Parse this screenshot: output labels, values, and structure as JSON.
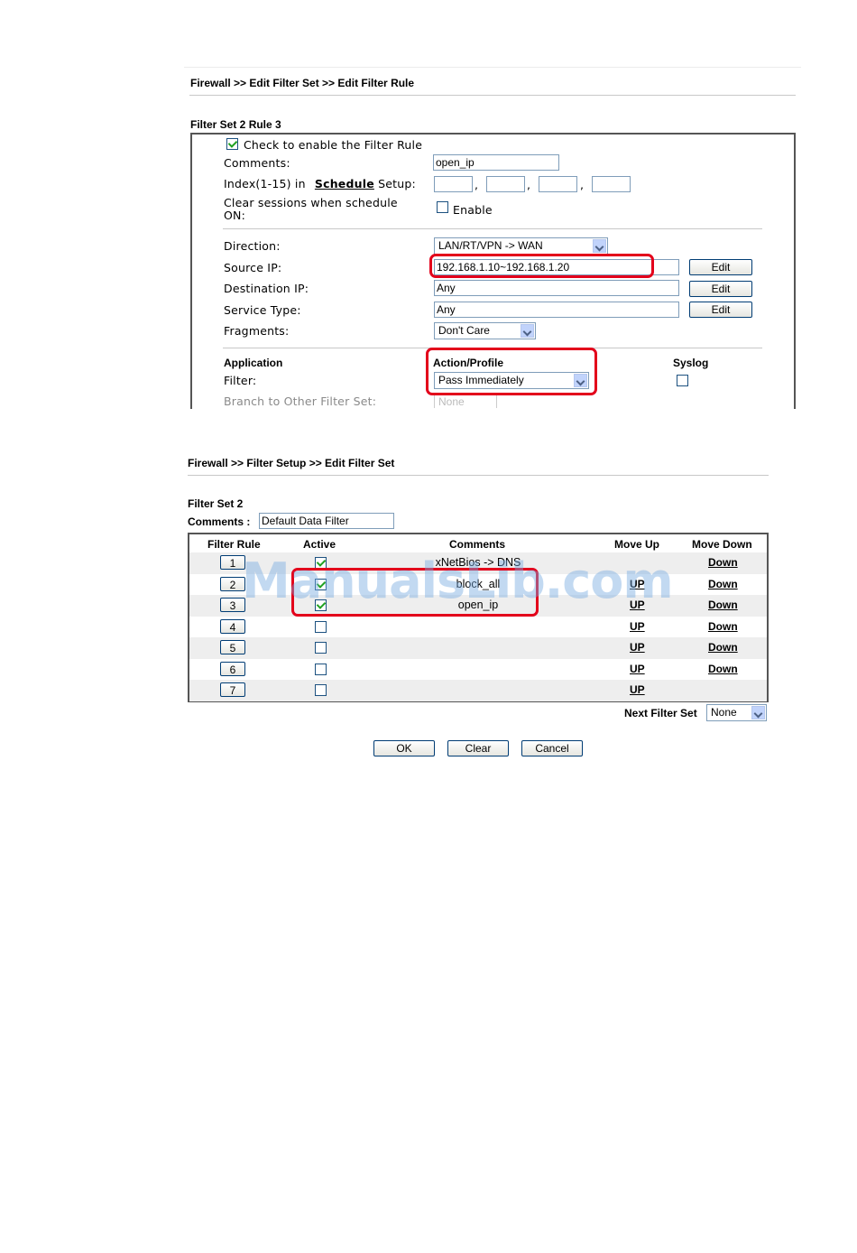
{
  "rule_page": {
    "breadcrumb": "Firewall >> Edit Filter Set >> Edit Filter Rule",
    "title": "Filter Set 2 Rule 3",
    "enable_label": "Check to enable the Filter Rule",
    "enable_checked": true,
    "comments_label": "Comments:",
    "comments_value": "open_ip",
    "index_label_pre": "Index(1-15) in",
    "index_schedule_link": "Schedule",
    "index_label_post": "Setup:",
    "index_sep": ",",
    "clear_label_1": "Clear sessions when schedule",
    "clear_label_2": "ON:",
    "clear_enable_label": "Enable",
    "direction_label": "Direction:",
    "direction_value": "LAN/RT/VPN -> WAN",
    "source_label": "Source IP:",
    "source_value": "192.168.1.10~192.168.1.20",
    "dest_label": "Destination IP:",
    "dest_value": "Any",
    "service_label": "Service Type:",
    "service_value": "Any",
    "edit_label": "Edit",
    "fragments_label": "Fragments:",
    "fragments_value": "Don't Care",
    "application_header": "Application",
    "action_header": "Action/Profile",
    "syslog_header": "Syslog",
    "filter_label": "Filter:",
    "filter_value": "Pass Immediately",
    "branch_label": "Branch to Other Filter Set:",
    "branch_value": "None"
  },
  "set_page": {
    "breadcrumb": "Firewall >> Filter Setup >> Edit Filter Set",
    "title": "Filter Set 2",
    "comments_label": "Comments :",
    "comments_value": "Default Data Filter",
    "columns": [
      "Filter Rule",
      "Active",
      "Comments",
      "Move Up",
      "Move Down"
    ],
    "rows": [
      {
        "num": "1",
        "active": true,
        "comment": "xNetBios -> DNS",
        "up": "",
        "down": "Down"
      },
      {
        "num": "2",
        "active": true,
        "comment": "block_all",
        "up": "UP",
        "down": "Down"
      },
      {
        "num": "3",
        "active": true,
        "comment": "open_ip",
        "up": "UP",
        "down": "Down"
      },
      {
        "num": "4",
        "active": false,
        "comment": "",
        "up": "UP",
        "down": "Down"
      },
      {
        "num": "5",
        "active": false,
        "comment": "",
        "up": "UP",
        "down": "Down"
      },
      {
        "num": "6",
        "active": false,
        "comment": "",
        "up": "UP",
        "down": "Down"
      },
      {
        "num": "7",
        "active": false,
        "comment": "",
        "up": "UP",
        "down": ""
      }
    ],
    "next_label": "Next Filter Set",
    "next_value": "None",
    "ok_label": "OK",
    "clear_label": "Clear",
    "cancel_label": "Cancel"
  },
  "watermark": "ManualsLib.com",
  "colors": {
    "highlight": "#e3001b",
    "watermark": "#78aae1"
  }
}
